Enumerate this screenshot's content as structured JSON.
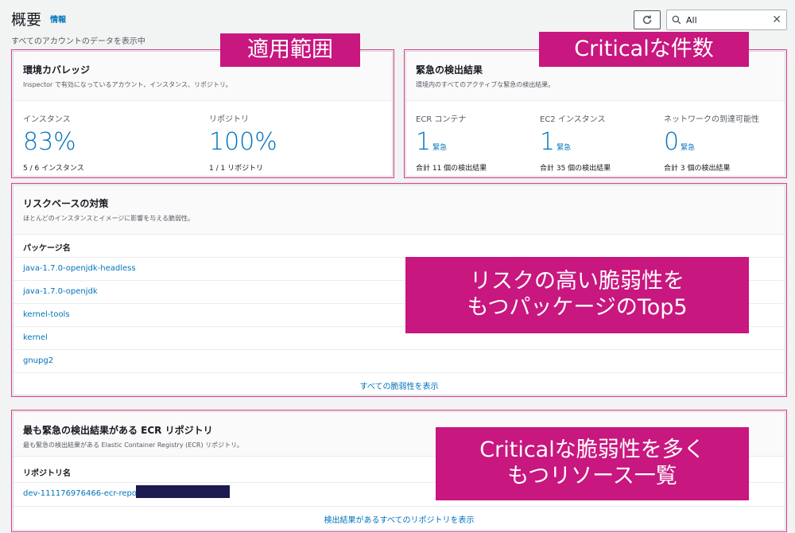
{
  "header": {
    "title": "概要",
    "info": "情報",
    "subtitle": "すべてのアカウントのデータを表示中"
  },
  "toolbar": {
    "search_value": "All"
  },
  "coverage": {
    "title": "環境カバレッジ",
    "desc": "Inspector で有効になっているアカウント、インスタンス、リポジトリ。",
    "instances": {
      "label": "インスタンス",
      "value": "83%",
      "foot": "5 / 6 インスタンス"
    },
    "repos": {
      "label": "リポジトリ",
      "value": "100%",
      "foot": "1 / 1 リポジトリ"
    }
  },
  "critical": {
    "title": "緊急の検出結果",
    "desc": "環境内のすべてのアクティブな緊急の検出結果。",
    "items": [
      {
        "label": "ECR コンテナ",
        "value": "1",
        "unit": "緊急",
        "foot": "合計 11 個の検出結果"
      },
      {
        "label": "EC2 インスタンス",
        "value": "1",
        "unit": "緊急",
        "foot": "合計 35 個の検出結果"
      },
      {
        "label": "ネットワークの到達可能性",
        "value": "0",
        "unit": "緊急",
        "foot": "合計 3 個の検出結果"
      }
    ]
  },
  "risk": {
    "title": "リスクベースの対策",
    "desc": "ほとんどのインスタンスとイメージに影響を与える脆弱性。",
    "column": "パッケージ名",
    "packages": [
      "java-1.7.0-openjdk-headless",
      "java-1.7.0-openjdk",
      "kernel-tools",
      "kernel",
      "gnupg2"
    ],
    "view_all": "すべての脆弱性を表示"
  },
  "ecr": {
    "title": "最も緊急の検出結果がある ECR リポジトリ",
    "desc": "最も緊急の検出結果がある Elastic Container Registry (ECR) リポジトリ。",
    "column": "リポジトリ名",
    "repo": "dev-111176976466-ecr-reposit",
    "view_all": "検出結果があるすべてのリポジトリを表示"
  },
  "callouts": {
    "scope": "適用範囲",
    "critical_count": "Criticalな件数",
    "top5_line1": "リスクの高い脆弱性を",
    "top5_line2": "もつパッケージのTop5",
    "resources_line1": "Criticalな脆弱性を多く",
    "resources_line2": "もつリソース一覧"
  },
  "colors": {
    "accent": "#0073bb",
    "callout": "#c8177f",
    "outline": "#e0368f"
  }
}
